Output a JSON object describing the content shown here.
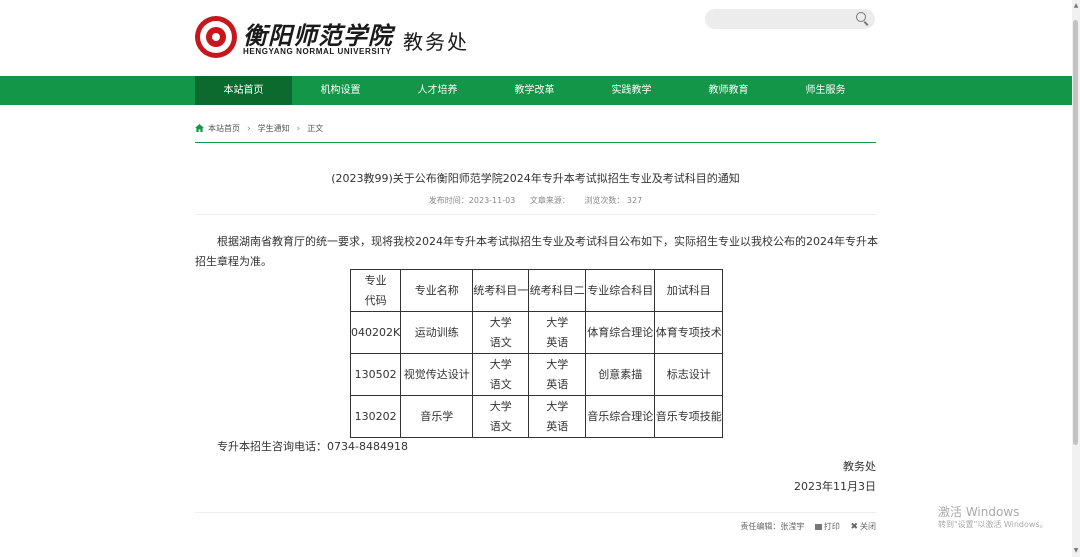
{
  "header": {
    "school_cn": "衡阳师范学院",
    "school_en": "HENGYANG NORMAL UNIVERSITY",
    "office": "教务处",
    "search_value": ""
  },
  "nav": {
    "items": [
      "本站首页",
      "机构设置",
      "人才培养",
      "教学改革",
      "实践教学",
      "教师教育",
      "师生服务"
    ]
  },
  "breadcrumb": {
    "items": [
      "本站首页",
      "学生通知",
      "正文"
    ]
  },
  "article": {
    "title": "(2023教99)关于公布衡阳师范学院2024年专升本考试拟招生专业及考试科目的通知",
    "meta": {
      "publish_time": "发布时间：2023-11-03",
      "source": "文章来源：",
      "views": "浏览次数：  327"
    },
    "paragraph": "根据湖南省教育厅的统一要求，现将我校2024年专升本考试拟招生专业及考试科目公布如下，实际招生专业以我校公布的2024年专升本招生章程为准。",
    "table": {
      "headers": [
        "专业\n代码",
        "专业名称",
        "统考科目一",
        "统考科目二",
        "专业综合科目",
        "加试科目"
      ],
      "rows": [
        [
          "040202K",
          "运动训练",
          "大学\n语文",
          "大学\n英语",
          "体育综合理论",
          "体育专项技术"
        ],
        [
          "130502",
          "视觉传达设计",
          "大学\n语文",
          "大学\n英语",
          "创意素描",
          "标志设计"
        ],
        [
          "130202",
          "音乐学",
          "大学\n语文",
          "大学\n英语",
          "音乐综合理论",
          "音乐专项技能"
        ]
      ]
    },
    "contact": "专升本招生咨询电话：0734-8484918",
    "signer": "教务处",
    "date": "2023年11月3日"
  },
  "footer": {
    "editor": "责任编辑：张滢宇",
    "print": "打印",
    "close": "关闭"
  },
  "watermark": {
    "line1": "激活 Windows",
    "line2": "转到\"设置\"以激活 Windows。"
  },
  "colors": {
    "nav_green": "#139648",
    "nav_active": "#0c6a2e",
    "logo_red": "#c8161d"
  }
}
